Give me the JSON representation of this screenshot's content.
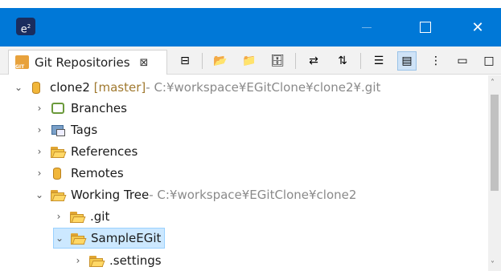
{
  "window": {
    "app_icon_text": "e",
    "app_icon_sup": "2",
    "minimize_glyph": "",
    "maximize_glyph": "",
    "close_glyph": "✕"
  },
  "view": {
    "tab_label": "Git Repositories",
    "tab_icon_text": "GIT",
    "tab_close": "⊠",
    "toolbar": [
      {
        "name": "collapse-all-icon",
        "glyph": "⊟"
      },
      {
        "name": "add-existing-repo-icon",
        "glyph": "📂"
      },
      {
        "name": "clone-repo-icon",
        "glyph": "📁"
      },
      {
        "name": "create-repo-icon",
        "glyph": "🗄"
      },
      {
        "name": "link-with-selection-icon",
        "glyph": "⇄"
      },
      {
        "name": "refresh-icon",
        "glyph": "⇅"
      },
      {
        "name": "hierarchical-layout-icon",
        "glyph": "☰"
      },
      {
        "name": "show-properties-icon",
        "glyph": "▤"
      },
      {
        "name": "view-menu-icon",
        "glyph": "⋮"
      },
      {
        "name": "minimize-view-icon",
        "glyph": "▭"
      },
      {
        "name": "maximize-view-icon",
        "glyph": "□"
      }
    ]
  },
  "tree": [
    {
      "label": "clone2",
      "branch": "[master]",
      "suffix": " - C:¥workspace¥EGitClone¥clone2¥.git",
      "expanded": true,
      "icon": "repository-icon"
    },
    {
      "label": "Branches",
      "expanded": false,
      "icon": "branches-icon"
    },
    {
      "label": "Tags",
      "expanded": false,
      "icon": "tags-icon"
    },
    {
      "label": "References",
      "expanded": false,
      "icon": "folder-icon"
    },
    {
      "label": "Remotes",
      "expanded": false,
      "icon": "remotes-icon"
    },
    {
      "label": "Working Tree",
      "suffix": " - C:¥workspace¥EGitClone¥clone2",
      "expanded": true,
      "icon": "folder-icon"
    },
    {
      "label": ".git",
      "expanded": false,
      "icon": "folder-icon"
    },
    {
      "label": "SampleEGit",
      "expanded": true,
      "selected": true,
      "icon": "folder-icon"
    },
    {
      "label": ".settings",
      "expanded": false,
      "icon": "folder-icon"
    }
  ],
  "colors": {
    "titlebar": "#0078d7",
    "selection": "#cce8ff",
    "branch_text": "#a0792f",
    "path_text": "#8a8a8a"
  }
}
